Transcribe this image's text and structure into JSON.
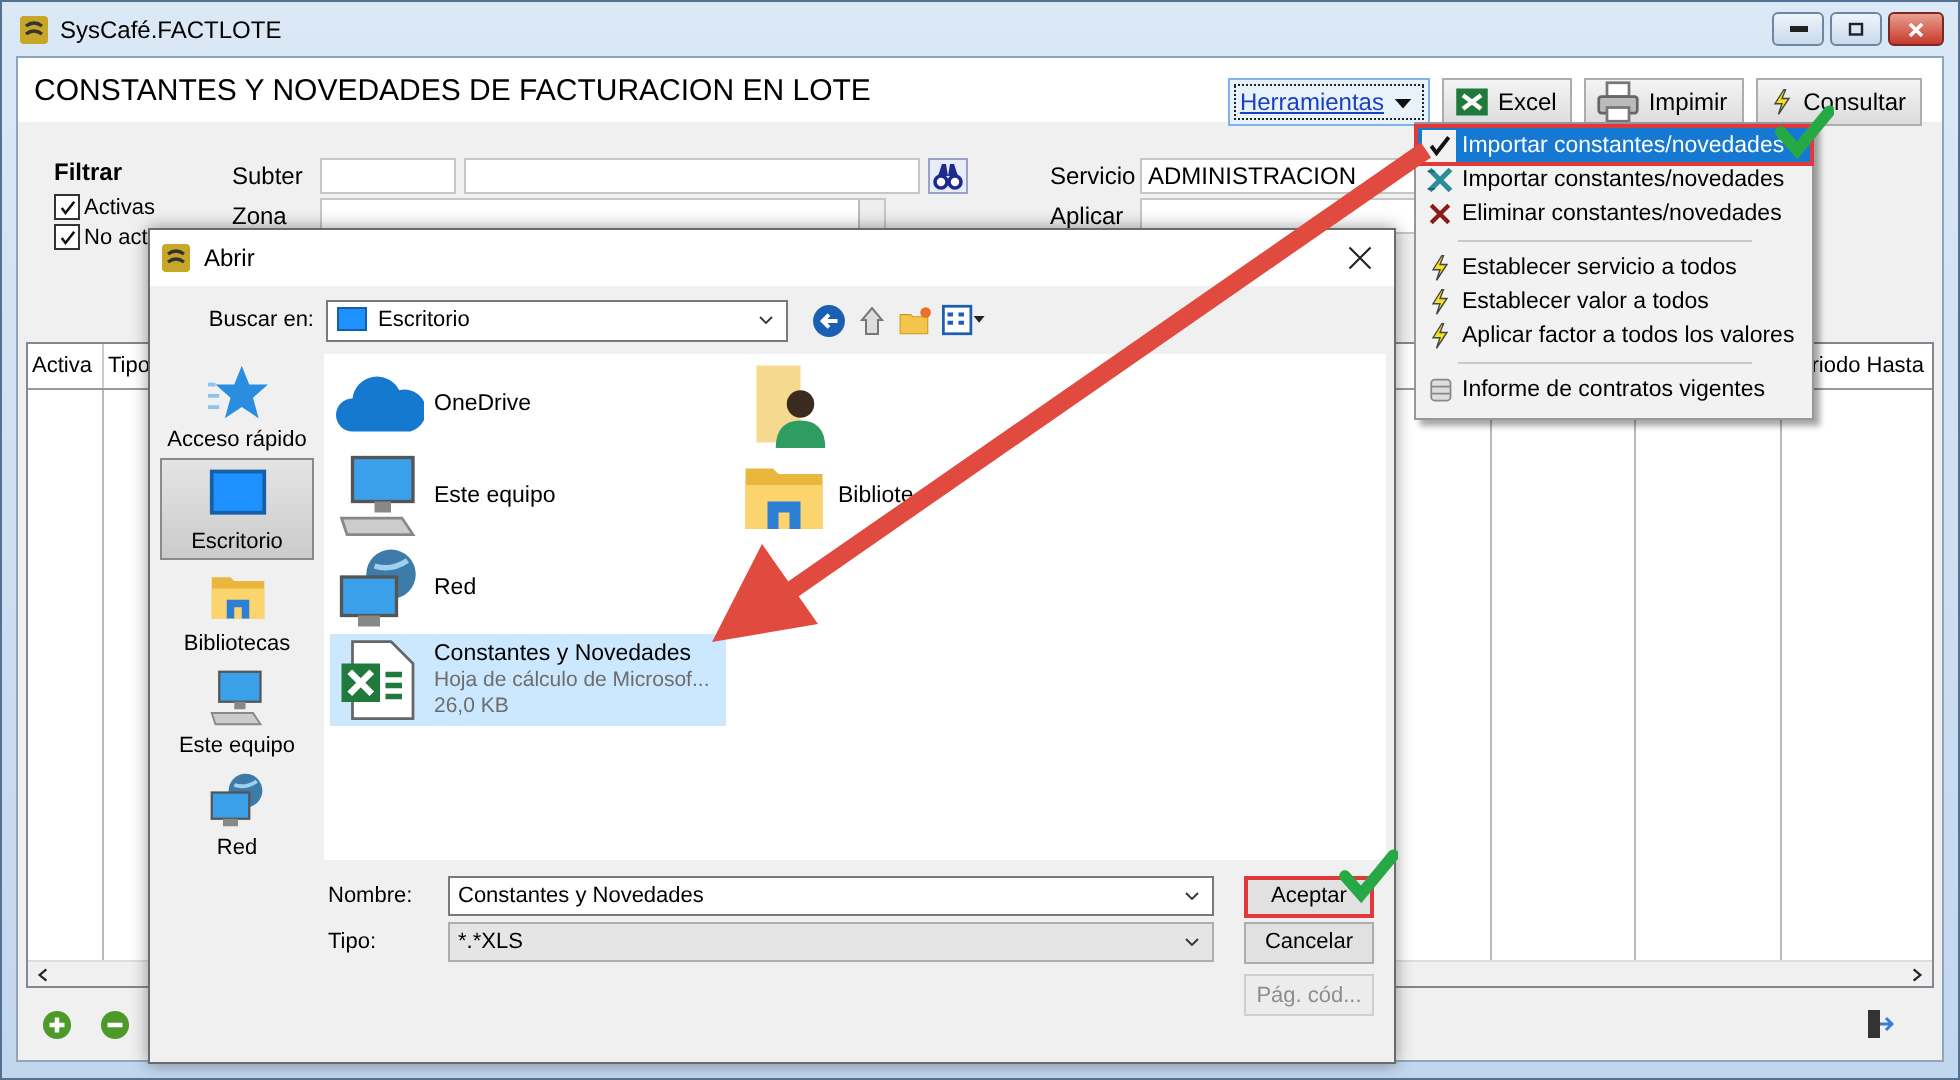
{
  "window": {
    "title": "SysCafé.FACTLOTE"
  },
  "header": {
    "title": "CONSTANTES Y NOVEDADES DE FACTURACION EN LOTE",
    "toolbar": [
      {
        "label": "Herramientas",
        "kind": "menu",
        "focused": true
      },
      {
        "label": "Excel",
        "kind": "excel",
        "focused": false
      },
      {
        "label": "Impimir",
        "kind": "printer",
        "focused": false
      },
      {
        "label": "Consultar",
        "kind": "bolt",
        "focused": false
      }
    ]
  },
  "filter": {
    "title": "Filtrar",
    "options": [
      {
        "label": "Activas",
        "checked": true
      },
      {
        "label": "No act",
        "checked": true
      }
    ]
  },
  "fields": {
    "subter": {
      "label": "Subter"
    },
    "zona": {
      "label": "Zona"
    },
    "servicio": {
      "label": "Servicio",
      "value": "ADMINISTRACION"
    },
    "aplicar": {
      "label": "Aplicar"
    }
  },
  "table": {
    "columns": [
      "Activa",
      "Tipo",
      "riodo Hasta"
    ]
  },
  "menu": {
    "items": [
      {
        "kind": "check",
        "label": "Importar constantes/novedades",
        "selected": true,
        "highlighted": true
      },
      {
        "kind": "excel",
        "label": "Importar constantes/novedades",
        "selected": false,
        "highlighted": false
      },
      {
        "kind": "delete",
        "label": "Eliminar constantes/novedades",
        "selected": false,
        "highlighted": false
      },
      {
        "kind": "separator"
      },
      {
        "kind": "bolt",
        "label": "Establecer servicio a todos",
        "selected": false,
        "highlighted": false
      },
      {
        "kind": "bolt",
        "label": "Establecer valor a todos",
        "selected": false,
        "highlighted": false
      },
      {
        "kind": "bolt",
        "label": "Aplicar factor a todos los valores",
        "selected": false,
        "highlighted": false
      },
      {
        "kind": "separator"
      },
      {
        "kind": "report",
        "label": "Informe de contratos vigentes",
        "selected": false,
        "highlighted": false
      }
    ]
  },
  "dialog": {
    "title": "Abrir",
    "look_in": {
      "label": "Buscar en:",
      "value": "Escritorio"
    },
    "places": [
      {
        "kind": "star",
        "label": "Acceso rápido",
        "selected": false
      },
      {
        "kind": "desktop",
        "label": "Escritorio",
        "selected": true
      },
      {
        "kind": "library",
        "label": "Bibliotecas",
        "selected": false
      },
      {
        "kind": "computer",
        "label": "Este equipo",
        "selected": false
      },
      {
        "kind": "network",
        "label": "Red",
        "selected": false
      }
    ],
    "file_rows": [
      [
        {
          "kind": "cloud",
          "name": "OneDrive",
          "selected": false
        },
        {
          "kind": "user",
          "selected": false
        }
      ],
      [
        {
          "kind": "computer",
          "name": "Este equipo",
          "selected": false
        },
        {
          "kind": "library",
          "name": "Bibliote",
          "selected": false
        }
      ],
      [
        {
          "kind": "network",
          "name": "Red",
          "selected": false
        }
      ],
      [
        {
          "kind": "excel",
          "name": "Constantes y Novedades",
          "type": "Hoja de cálculo de Microsof...",
          "size": "26,0 KB",
          "selected": true
        }
      ]
    ],
    "name_field": {
      "label": "Nombre:",
      "value": "Constantes y Novedades"
    },
    "type_field": {
      "label": "Tipo:",
      "value": "*.*XLS"
    },
    "buttons": [
      {
        "label": "Aceptar",
        "disabled": false,
        "highlighted": true
      },
      {
        "label": "Cancelar",
        "disabled": false,
        "highlighted": false
      },
      {
        "label": "Pág. cód...",
        "disabled": true,
        "highlighted": false
      }
    ]
  }
}
